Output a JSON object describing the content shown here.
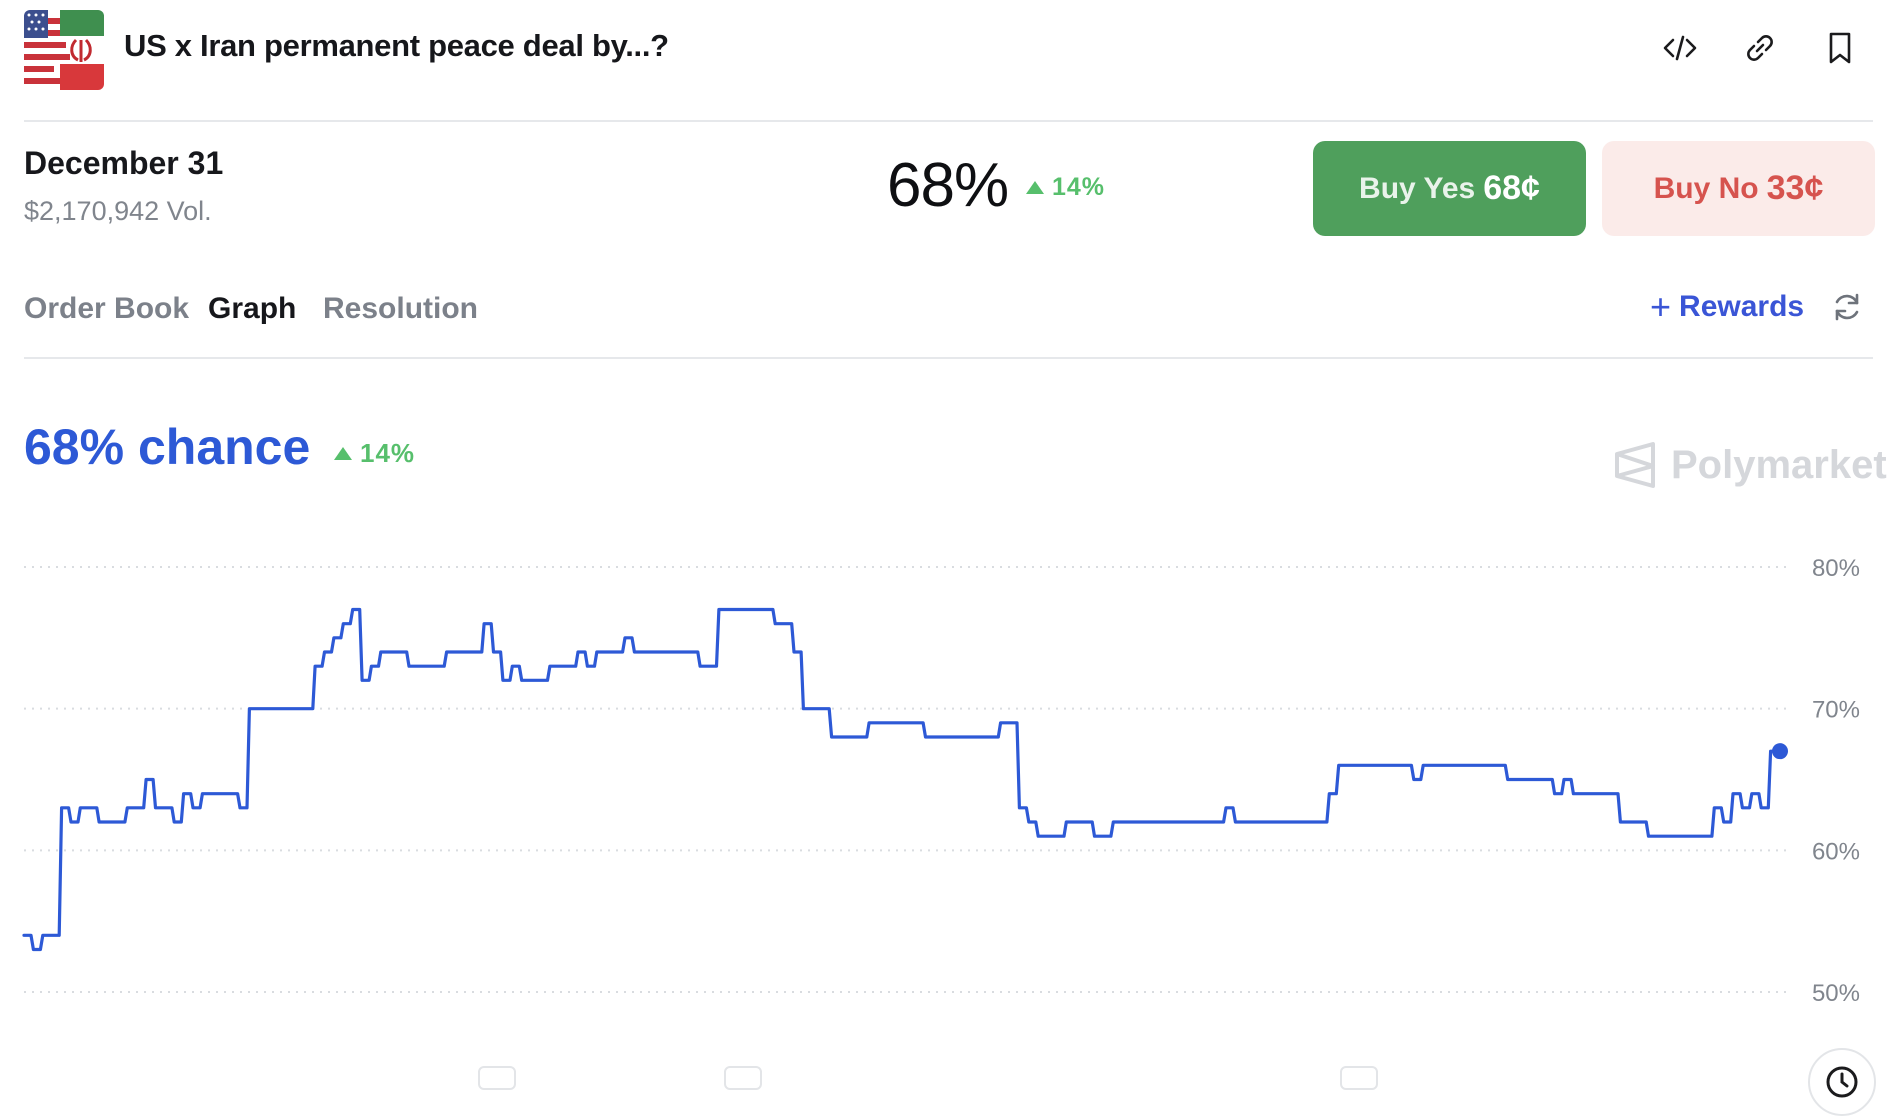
{
  "header": {
    "title": "US x Iran permanent peace deal by...?",
    "icons": [
      "embed-code-icon",
      "link-icon",
      "bookmark-icon"
    ]
  },
  "summary": {
    "date": "December 31",
    "volume": "$2,170,942 Vol.",
    "percent": "68%",
    "change": "14%",
    "buy_yes_label": "Buy Yes",
    "buy_yes_price": "68¢",
    "buy_no_label": "Buy No",
    "buy_no_price": "33¢"
  },
  "tabs": [
    {
      "label": "Order Book",
      "active": false
    },
    {
      "label": "Graph",
      "active": true
    },
    {
      "label": "Resolution",
      "active": false
    }
  ],
  "rewards_label": "Rewards",
  "chance": {
    "label": "68% chance",
    "change": "14%"
  },
  "logo_text": "Polymarket",
  "colors": {
    "line": "#2d59d6",
    "positive": "#57bf6c",
    "yes": "#4f9f5c",
    "no": "#d6534e"
  },
  "chart_data": {
    "type": "line",
    "ylim": [
      45,
      82
    ],
    "ytick_labels": [
      "80%",
      "70%",
      "60%",
      "50%"
    ],
    "yticks": [
      80,
      70,
      60,
      50
    ],
    "grid": true,
    "series": [
      {
        "values": [
          54,
          53,
          54,
          54,
          63,
          62,
          63,
          63,
          62,
          62,
          62,
          63,
          63,
          65,
          63,
          63,
          62,
          64,
          63,
          64,
          64,
          64,
          64,
          63,
          70,
          70,
          70,
          70,
          70,
          70,
          70,
          73,
          74,
          75,
          76,
          77,
          72,
          73,
          74,
          74,
          74,
          73,
          73,
          73,
          73,
          74,
          74,
          74,
          74,
          76,
          74,
          72,
          73,
          72,
          72,
          72,
          73,
          73,
          73,
          74,
          73,
          74,
          74,
          74,
          75,
          74,
          74,
          74,
          74,
          74,
          74,
          74,
          73,
          73,
          77,
          77,
          77,
          77,
          77,
          77,
          76,
          76,
          74,
          70,
          70,
          70,
          68,
          68,
          68,
          68,
          69,
          69,
          69,
          69,
          69,
          69,
          68,
          68,
          68,
          68,
          68,
          68,
          68,
          68,
          69,
          69,
          63,
          62,
          61,
          61,
          61,
          62,
          62,
          62,
          61,
          61,
          62,
          62,
          62,
          62,
          62,
          62,
          62,
          62,
          62,
          62,
          62,
          62,
          63,
          62,
          62,
          62,
          62,
          62,
          62,
          62,
          62,
          62,
          62,
          64,
          66,
          66,
          66,
          66,
          66,
          66,
          66,
          66,
          65,
          66,
          66,
          66,
          66,
          66,
          66,
          66,
          66,
          66,
          65,
          65,
          65,
          65,
          65,
          64,
          65,
          64,
          64,
          64,
          64,
          64,
          62,
          62,
          62,
          61,
          61,
          61,
          61,
          61,
          61,
          61,
          63,
          62,
          64,
          63,
          64,
          63,
          67,
          67
        ]
      }
    ]
  }
}
